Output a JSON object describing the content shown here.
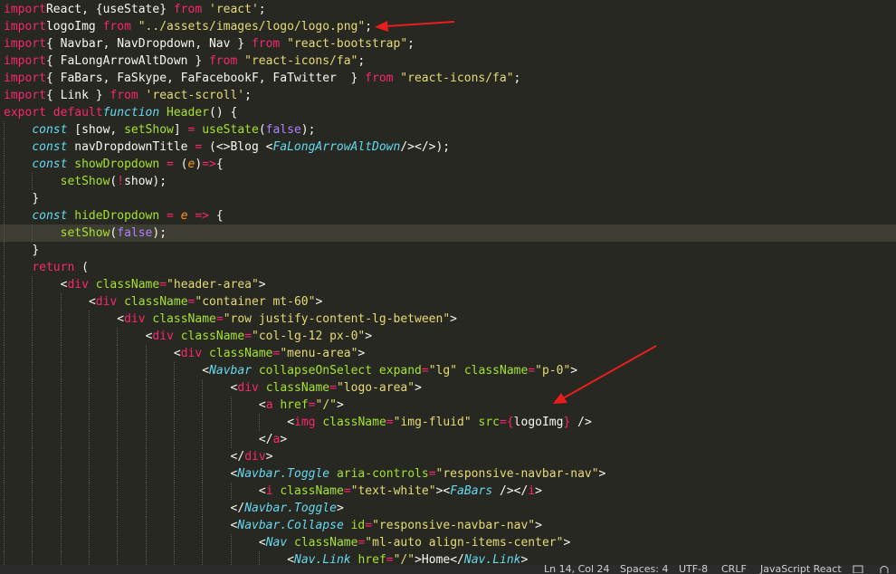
{
  "editor": {
    "current_line_index": 13,
    "lines": [
      {
        "indent": 0,
        "tokens": [
          [
            "kw",
            "import"
          ],
          [
            "",
            "React, {useState} "
          ],
          [
            "kw",
            "from"
          ],
          [
            "",
            ""
          ],
          [
            "str",
            " 'react'"
          ],
          [
            "",
            ";"
          ]
        ]
      },
      {
        "indent": 0,
        "tokens": [
          [
            "kw",
            "import"
          ],
          [
            "",
            "",
            " "
          ],
          [
            "",
            "logoImg "
          ],
          [
            "kw",
            "from"
          ],
          [
            "str",
            " \"../assets/images/logo/logo.png\""
          ],
          [
            "",
            ";"
          ]
        ]
      },
      {
        "indent": 0,
        "tokens": [
          [
            "kw",
            "import"
          ],
          [
            "",
            "",
            " "
          ],
          [
            "",
            "{ Navbar, NavDropdown, Nav } "
          ],
          [
            "kw",
            "from"
          ],
          [
            "str",
            " \"react-bootstrap\""
          ],
          [
            "",
            ";"
          ]
        ]
      },
      {
        "indent": 0,
        "tokens": [
          [
            "kw",
            "import"
          ],
          [
            "",
            "",
            " "
          ],
          [
            "",
            "{ FaLongArrowAltDown } "
          ],
          [
            "kw",
            "from"
          ],
          [
            "str",
            " \"react-icons/fa\""
          ],
          [
            "",
            ";"
          ]
        ]
      },
      {
        "indent": 0,
        "tokens": [
          [
            "kw",
            "import"
          ],
          [
            "",
            "",
            " "
          ],
          [
            "",
            "{ FaBars, FaSkype, FaFacebookF, FaTwitter  } "
          ],
          [
            "kw",
            "from"
          ],
          [
            "str",
            " \"react-icons/fa\""
          ],
          [
            "",
            ";"
          ]
        ]
      },
      {
        "indent": 0,
        "tokens": [
          [
            "kw",
            "import"
          ],
          [
            "",
            "",
            " "
          ],
          [
            "",
            "{ Link } "
          ],
          [
            "kw",
            "from"
          ],
          [
            "str",
            " 'react-scroll'"
          ],
          [
            "",
            ";"
          ]
        ]
      },
      {
        "indent": 0,
        "tokens": [
          [
            "kw",
            "export default"
          ],
          [
            "",
            "",
            " "
          ],
          [
            "st",
            "function"
          ],
          [
            "",
            " "
          ],
          [
            "fn",
            "Header"
          ],
          [
            "",
            "() {"
          ]
        ]
      },
      {
        "indent": 1,
        "tokens": [
          [
            "st",
            "const"
          ],
          [
            "",
            " [show, "
          ],
          [
            "fn",
            "setShow"
          ],
          [
            "",
            "] "
          ],
          [
            "op",
            "="
          ],
          [
            "",
            " "
          ],
          [
            "fn",
            "useState"
          ],
          [
            "",
            "("
          ],
          [
            "const",
            "false"
          ],
          [
            "",
            ");"
          ]
        ]
      },
      {
        "indent": 1,
        "tokens": [
          [
            "st",
            "const"
          ],
          [
            "",
            " navDropdownTitle "
          ],
          [
            "op",
            "="
          ],
          [
            "",
            " (<>Blog <"
          ],
          [
            "comp",
            "FaLongArrowAltDown"
          ],
          [
            "",
            "/></>);"
          ]
        ]
      },
      {
        "indent": 1,
        "tokens": [
          [
            "st",
            "const"
          ],
          [
            "",
            " "
          ],
          [
            "fn",
            "showDropdown"
          ],
          [
            "",
            " "
          ],
          [
            "op",
            "="
          ],
          [
            "",
            " ("
          ],
          [
            "param",
            "e"
          ],
          [
            "",
            ")"
          ],
          [
            "op",
            "=>"
          ],
          [
            "",
            "{"
          ]
        ]
      },
      {
        "indent": 2,
        "tokens": [
          [
            "fn",
            "setShow"
          ],
          [
            "",
            "("
          ],
          [
            "op",
            "!"
          ],
          [
            "",
            "show);"
          ]
        ]
      },
      {
        "indent": 1,
        "tokens": [
          [
            "",
            "}"
          ]
        ]
      },
      {
        "indent": 1,
        "tokens": [
          [
            "st",
            "const"
          ],
          [
            "",
            " "
          ],
          [
            "fn",
            "hideDropdown"
          ],
          [
            "",
            " "
          ],
          [
            "op",
            "="
          ],
          [
            "",
            " "
          ],
          [
            "param",
            "e"
          ],
          [
            "",
            " "
          ],
          [
            "op",
            "=>"
          ],
          [
            "",
            " {"
          ]
        ]
      },
      {
        "indent": 2,
        "tokens": [
          [
            "fn",
            "setShow"
          ],
          [
            "",
            "("
          ],
          [
            "const",
            "false"
          ],
          [
            "",
            ");"
          ]
        ]
      },
      {
        "indent": 1,
        "tokens": [
          [
            "",
            "}"
          ]
        ]
      },
      {
        "indent": 1,
        "tokens": [
          [
            "kw",
            "return"
          ],
          [
            "",
            " ("
          ]
        ]
      },
      {
        "indent": 2,
        "tokens": [
          [
            "",
            "<"
          ],
          [
            "tag",
            "div"
          ],
          [
            "",
            " "
          ],
          [
            "attr",
            "className"
          ],
          [
            "op",
            "="
          ],
          [
            "str",
            "\"header-area\""
          ],
          [
            "",
            ">"
          ]
        ]
      },
      {
        "indent": 3,
        "tokens": [
          [
            "",
            "<"
          ],
          [
            "tag",
            "div"
          ],
          [
            "",
            " "
          ],
          [
            "attr",
            "className"
          ],
          [
            "op",
            "="
          ],
          [
            "str",
            "\"container mt-60\""
          ],
          [
            "",
            ">"
          ]
        ]
      },
      {
        "indent": 4,
        "tokens": [
          [
            "",
            "<"
          ],
          [
            "tag",
            "div"
          ],
          [
            "",
            " "
          ],
          [
            "attr",
            "className"
          ],
          [
            "op",
            "="
          ],
          [
            "str",
            "\"row justify-content-lg-between\""
          ],
          [
            "",
            ">"
          ]
        ]
      },
      {
        "indent": 5,
        "tokens": [
          [
            "",
            "<"
          ],
          [
            "tag",
            "div"
          ],
          [
            "",
            " "
          ],
          [
            "attr",
            "className"
          ],
          [
            "op",
            "="
          ],
          [
            "str",
            "\"col-lg-12 px-0\""
          ],
          [
            "",
            ">"
          ]
        ]
      },
      {
        "indent": 6,
        "tokens": [
          [
            "",
            "<"
          ],
          [
            "tag",
            "div"
          ],
          [
            "",
            " "
          ],
          [
            "attr",
            "className"
          ],
          [
            "op",
            "="
          ],
          [
            "str",
            "\"menu-area\""
          ],
          [
            "",
            ">"
          ]
        ]
      },
      {
        "indent": 7,
        "tokens": [
          [
            "",
            "<"
          ],
          [
            "comp",
            "Navbar"
          ],
          [
            "",
            " "
          ],
          [
            "attr",
            "collapseOnSelect"
          ],
          [
            "",
            " "
          ],
          [
            "attr",
            "expand"
          ],
          [
            "op",
            "="
          ],
          [
            "str",
            "\"lg\""
          ],
          [
            "",
            " "
          ],
          [
            "attr",
            "className"
          ],
          [
            "op",
            "="
          ],
          [
            "str",
            "\"p-0\""
          ],
          [
            "",
            ">"
          ]
        ]
      },
      {
        "indent": 8,
        "tokens": [
          [
            "",
            "<"
          ],
          [
            "tag",
            "div"
          ],
          [
            "",
            " "
          ],
          [
            "attr",
            "className"
          ],
          [
            "op",
            "="
          ],
          [
            "str",
            "\"logo-area\""
          ],
          [
            "",
            ">"
          ]
        ]
      },
      {
        "indent": 9,
        "tokens": [
          [
            "",
            "<"
          ],
          [
            "tag",
            "a"
          ],
          [
            "",
            " "
          ],
          [
            "attr",
            "href"
          ],
          [
            "op",
            "="
          ],
          [
            "str",
            "\"/\""
          ],
          [
            "",
            ">"
          ]
        ]
      },
      {
        "indent": 10,
        "tokens": [
          [
            "",
            "<"
          ],
          [
            "tag",
            "img"
          ],
          [
            "",
            " "
          ],
          [
            "attr",
            "className"
          ],
          [
            "op",
            "="
          ],
          [
            "str",
            "\"img-fluid\""
          ],
          [
            "",
            " "
          ],
          [
            "attr",
            "src"
          ],
          [
            "op",
            "={"
          ],
          [
            "",
            "logoImg"
          ],
          [
            "op",
            "}"
          ],
          [
            "",
            " />"
          ]
        ]
      },
      {
        "indent": 9,
        "tokens": [
          [
            "",
            "</"
          ],
          [
            "tag",
            "a"
          ],
          [
            "",
            ">"
          ]
        ]
      },
      {
        "indent": 8,
        "tokens": [
          [
            "",
            "</"
          ],
          [
            "tag",
            "div"
          ],
          [
            "",
            ">"
          ]
        ]
      },
      {
        "indent": 8,
        "tokens": [
          [
            "",
            "<"
          ],
          [
            "comp",
            "Navbar.Toggle"
          ],
          [
            "",
            " "
          ],
          [
            "attr",
            "aria-controls"
          ],
          [
            "op",
            "="
          ],
          [
            "str",
            "\"responsive-navbar-nav\""
          ],
          [
            "",
            ">"
          ]
        ]
      },
      {
        "indent": 9,
        "tokens": [
          [
            "",
            "<"
          ],
          [
            "tag",
            "i"
          ],
          [
            "",
            " "
          ],
          [
            "attr",
            "className"
          ],
          [
            "op",
            "="
          ],
          [
            "str",
            "\"text-white\""
          ],
          [
            "",
            "><"
          ],
          [
            "comp",
            "FaBars"
          ],
          [
            "",
            " /></"
          ],
          [
            "tag",
            "i"
          ],
          [
            "",
            ">"
          ]
        ]
      },
      {
        "indent": 8,
        "tokens": [
          [
            "",
            "</"
          ],
          [
            "comp",
            "Navbar.Toggle"
          ],
          [
            "",
            ">"
          ]
        ]
      },
      {
        "indent": 8,
        "tokens": [
          [
            "",
            "<"
          ],
          [
            "comp",
            "Navbar.Collapse"
          ],
          [
            "",
            " "
          ],
          [
            "attr",
            "id"
          ],
          [
            "op",
            "="
          ],
          [
            "str",
            "\"responsive-navbar-nav\""
          ],
          [
            "",
            ">"
          ]
        ]
      },
      {
        "indent": 9,
        "tokens": [
          [
            "",
            "<"
          ],
          [
            "comp",
            "Nav"
          ],
          [
            "",
            " "
          ],
          [
            "attr",
            "className"
          ],
          [
            "op",
            "="
          ],
          [
            "str",
            "\"ml-auto align-items-center\""
          ],
          [
            "",
            ">"
          ]
        ]
      },
      {
        "indent": 10,
        "tokens": [
          [
            "",
            "<"
          ],
          [
            "comp",
            "Nav.Link"
          ],
          [
            "",
            " "
          ],
          [
            "attr",
            "href"
          ],
          [
            "op",
            "="
          ],
          [
            "str",
            "\"/\""
          ],
          [
            "",
            ">Home</"
          ],
          [
            "comp",
            "Nav.Link"
          ],
          [
            "",
            ">"
          ]
        ]
      }
    ]
  },
  "statusbar": {
    "position": "Ln 14, Col 24",
    "spaces": "Spaces: 4",
    "encoding": "UTF-8",
    "eol": "CRLF",
    "language": "JavaScript React"
  },
  "colors": {
    "background": "#272822",
    "arrow": "#e81e1e"
  },
  "icons": [
    "feedback-icon",
    "bell-icon"
  ]
}
